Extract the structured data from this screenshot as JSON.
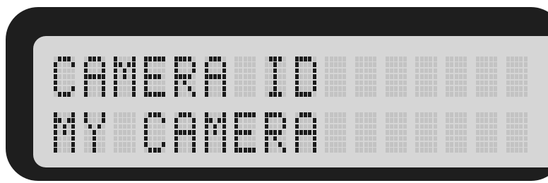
{
  "display": {
    "line1": "CAMERA ID",
    "line2": "MY CAMERA"
  },
  "colors": {
    "bezel": "#1e1e1e",
    "lcd_background": "#d6d6d6",
    "pixel_on": "#1a1a1a",
    "pixel_off": "#c3c3c3"
  }
}
